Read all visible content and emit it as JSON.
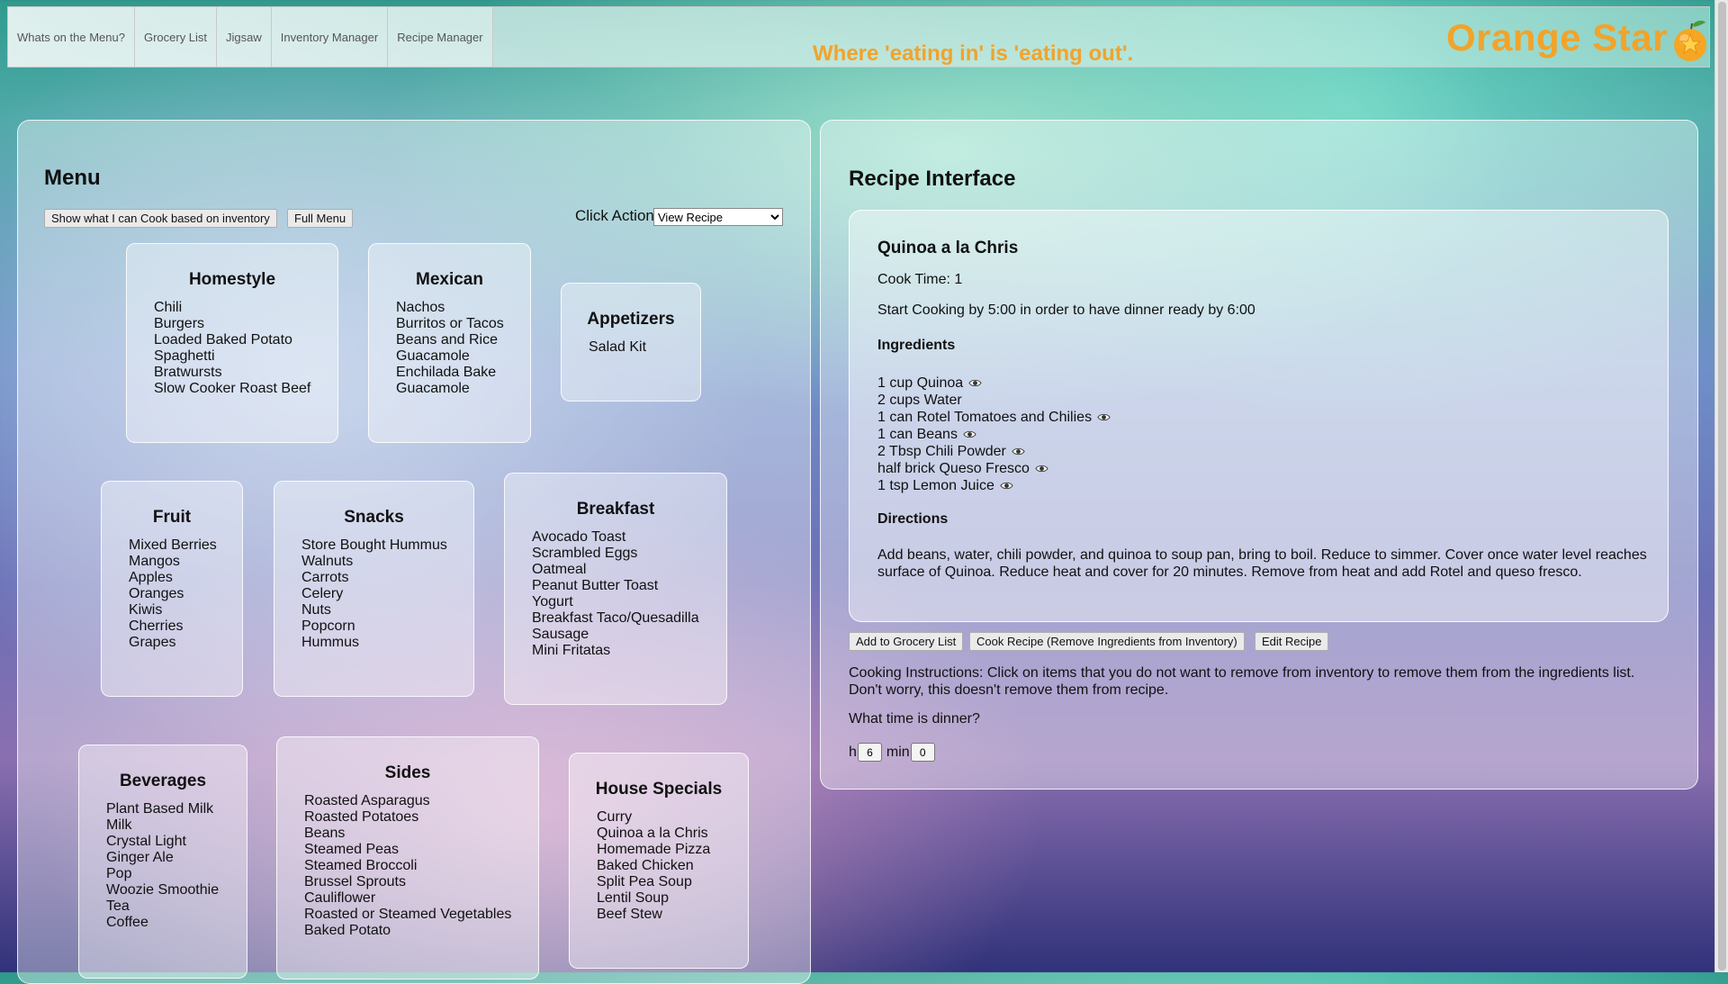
{
  "nav": {
    "tabs": [
      "Whats on the Menu?",
      "Grocery List",
      "Jigsaw",
      "Inventory Manager",
      "Recipe Manager"
    ],
    "tagline": "Where 'eating in' is 'eating out'.",
    "brand": "Orange Star",
    "brand_icon": "orange-star-icon",
    "brand_color": "#f2a32a"
  },
  "menu": {
    "title": "Menu",
    "btn_cook_inventory": "Show what I can Cook based on inventory",
    "btn_full_menu": "Full Menu",
    "click_action_label": "Click Action",
    "click_action_selected": "View Recipe",
    "categories": [
      {
        "name": "Homestyle",
        "items": [
          "Chili",
          "Burgers",
          "Loaded Baked Potato",
          "Spaghetti",
          "Bratwursts",
          "Slow Cooker Roast Beef"
        ]
      },
      {
        "name": "Mexican",
        "items": [
          "Nachos",
          "Burritos or Tacos",
          "Beans and Rice",
          "Guacamole",
          "Enchilada Bake",
          "Guacamole"
        ]
      },
      {
        "name": "Appetizers",
        "items": [
          "Salad Kit"
        ]
      },
      {
        "name": "Fruit",
        "items": [
          "Mixed Berries",
          "Mangos",
          "Apples",
          "Oranges",
          "Kiwis",
          "Cherries",
          "Grapes"
        ]
      },
      {
        "name": "Snacks",
        "items": [
          "Store Bought Hummus",
          "Walnuts",
          "Carrots",
          "Celery",
          "Nuts",
          "Popcorn",
          "Hummus"
        ]
      },
      {
        "name": "Breakfast",
        "items": [
          "Avocado Toast",
          "Scrambled Eggs",
          "Oatmeal",
          "Peanut Butter Toast",
          "Yogurt",
          "Breakfast Taco/Quesadilla",
          "Sausage",
          "Mini Fritatas"
        ]
      },
      {
        "name": "Beverages",
        "items": [
          "Plant Based Milk",
          "Milk",
          "Crystal Light",
          "Ginger Ale",
          "Pop",
          "Woozie Smoothie",
          "Tea",
          "Coffee"
        ]
      },
      {
        "name": "Sides",
        "items": [
          "Roasted Asparagus",
          "Roasted Potatoes",
          "Beans",
          "Steamed Peas",
          "Steamed Broccoli",
          "Brussel Sprouts",
          "Cauliflower",
          "Roasted or Steamed Vegetables",
          "Baked Potato"
        ]
      },
      {
        "name": "House Specials",
        "items": [
          "Curry",
          "Quinoa a la Chris",
          "Homemade Pizza",
          "Baked Chicken",
          "Split Pea Soup",
          "Lentil Soup",
          "Beef Stew"
        ]
      }
    ]
  },
  "recipe": {
    "panel_title": "Recipe Interface",
    "name": "Quinoa a la Chris",
    "cook_time": "Cook Time: 1",
    "start_cooking": "Start Cooking by 5:00 in order to have dinner ready by 6:00",
    "ingredients_heading": "Ingredients",
    "ingredients": [
      {
        "text": "1 cup Quinoa",
        "icon": "eye-icon"
      },
      {
        "text": "2 cups Water",
        "icon": ""
      },
      {
        "text": "1 can Rotel Tomatoes and Chilies",
        "icon": "eye-icon"
      },
      {
        "text": "1 can Beans",
        "icon": "eye-icon"
      },
      {
        "text": "2 Tbsp Chili Powder",
        "icon": "eye-icon"
      },
      {
        "text": "half brick Queso Fresco",
        "icon": "eye-icon"
      },
      {
        "text": "1 tsp Lemon Juice",
        "icon": "eye-icon"
      }
    ],
    "directions_heading": "Directions",
    "directions": "Add beans, water, chili powder, and quinoa to soup pan, bring to boil. Reduce to simmer. Cover once water level reaches surface of Quinoa. Reduce heat and cover for 20 minutes. Remove from heat and add Rotel and queso fresco.",
    "btn_grocery": "Add to Grocery List",
    "btn_cook": "Cook Recipe (Remove Ingredients from Inventory)",
    "btn_edit": "Edit Recipe",
    "cooking_instructions": "Cooking Instructions: Click on items that you do not want to remove from inventory to remove them from the ingredients list. Don't worry, this doesn't remove them from recipe.",
    "dinner_question": "What time is dinner?",
    "hour_label": "h",
    "hour_value": "6",
    "min_label": "min",
    "min_value": "0"
  }
}
